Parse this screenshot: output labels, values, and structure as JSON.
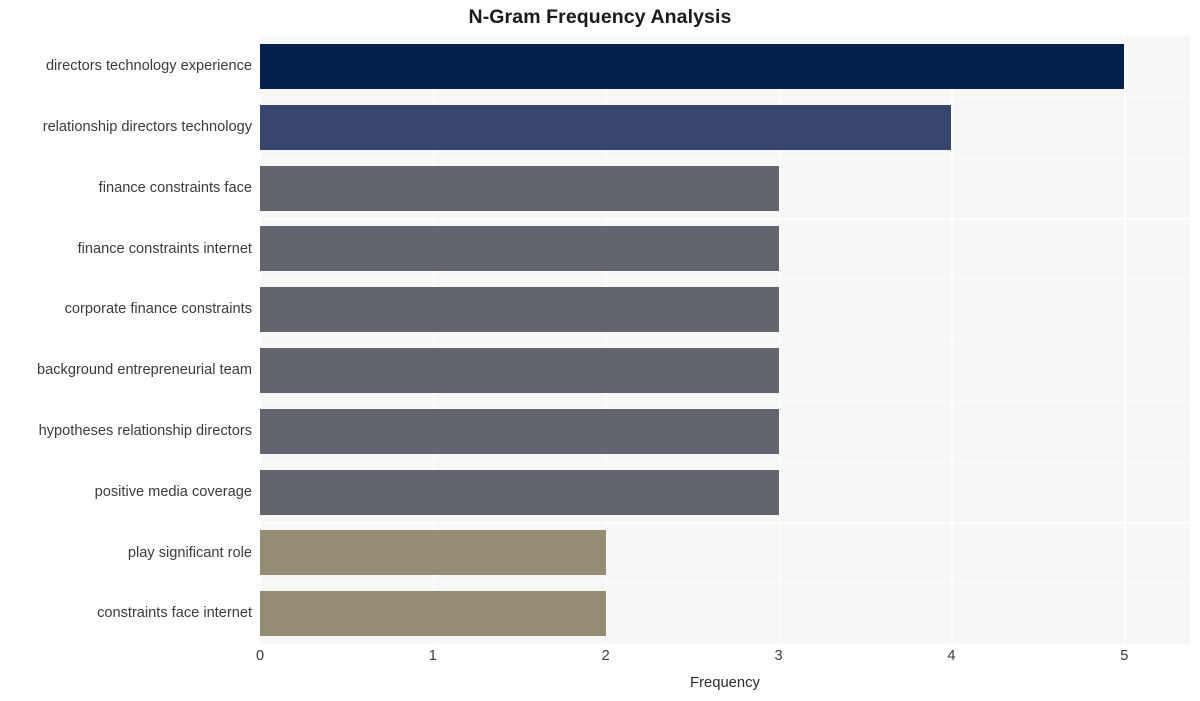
{
  "chart_data": {
    "type": "bar",
    "orientation": "horizontal",
    "title": "N-Gram Frequency Analysis",
    "xlabel": "Frequency",
    "ylabel": "",
    "categories": [
      "directors technology experience",
      "relationship directors technology",
      "finance constraints face",
      "finance constraints internet",
      "corporate finance constraints",
      "background entrepreneurial team",
      "hypotheses relationship directors",
      "positive media coverage",
      "play significant role",
      "constraints face internet"
    ],
    "values": [
      5,
      4,
      3,
      3,
      3,
      3,
      3,
      3,
      2,
      2
    ],
    "bar_colors": [
      "#04214c",
      "#37456f",
      "#63656e",
      "#63656e",
      "#63656e",
      "#63656e",
      "#63656e",
      "#63656e",
      "#948d74",
      "#948d74"
    ],
    "xlim": [
      0,
      5.38
    ],
    "xticks": [
      0,
      1,
      2,
      3,
      4,
      5
    ],
    "xtick_labels": [
      "0",
      "1",
      "2",
      "3",
      "4",
      "5"
    ],
    "grid": true,
    "grid_color": "#ffffff",
    "plot_background": "#f7f7f8",
    "figure_background": "#ffffff",
    "legend": null
  }
}
